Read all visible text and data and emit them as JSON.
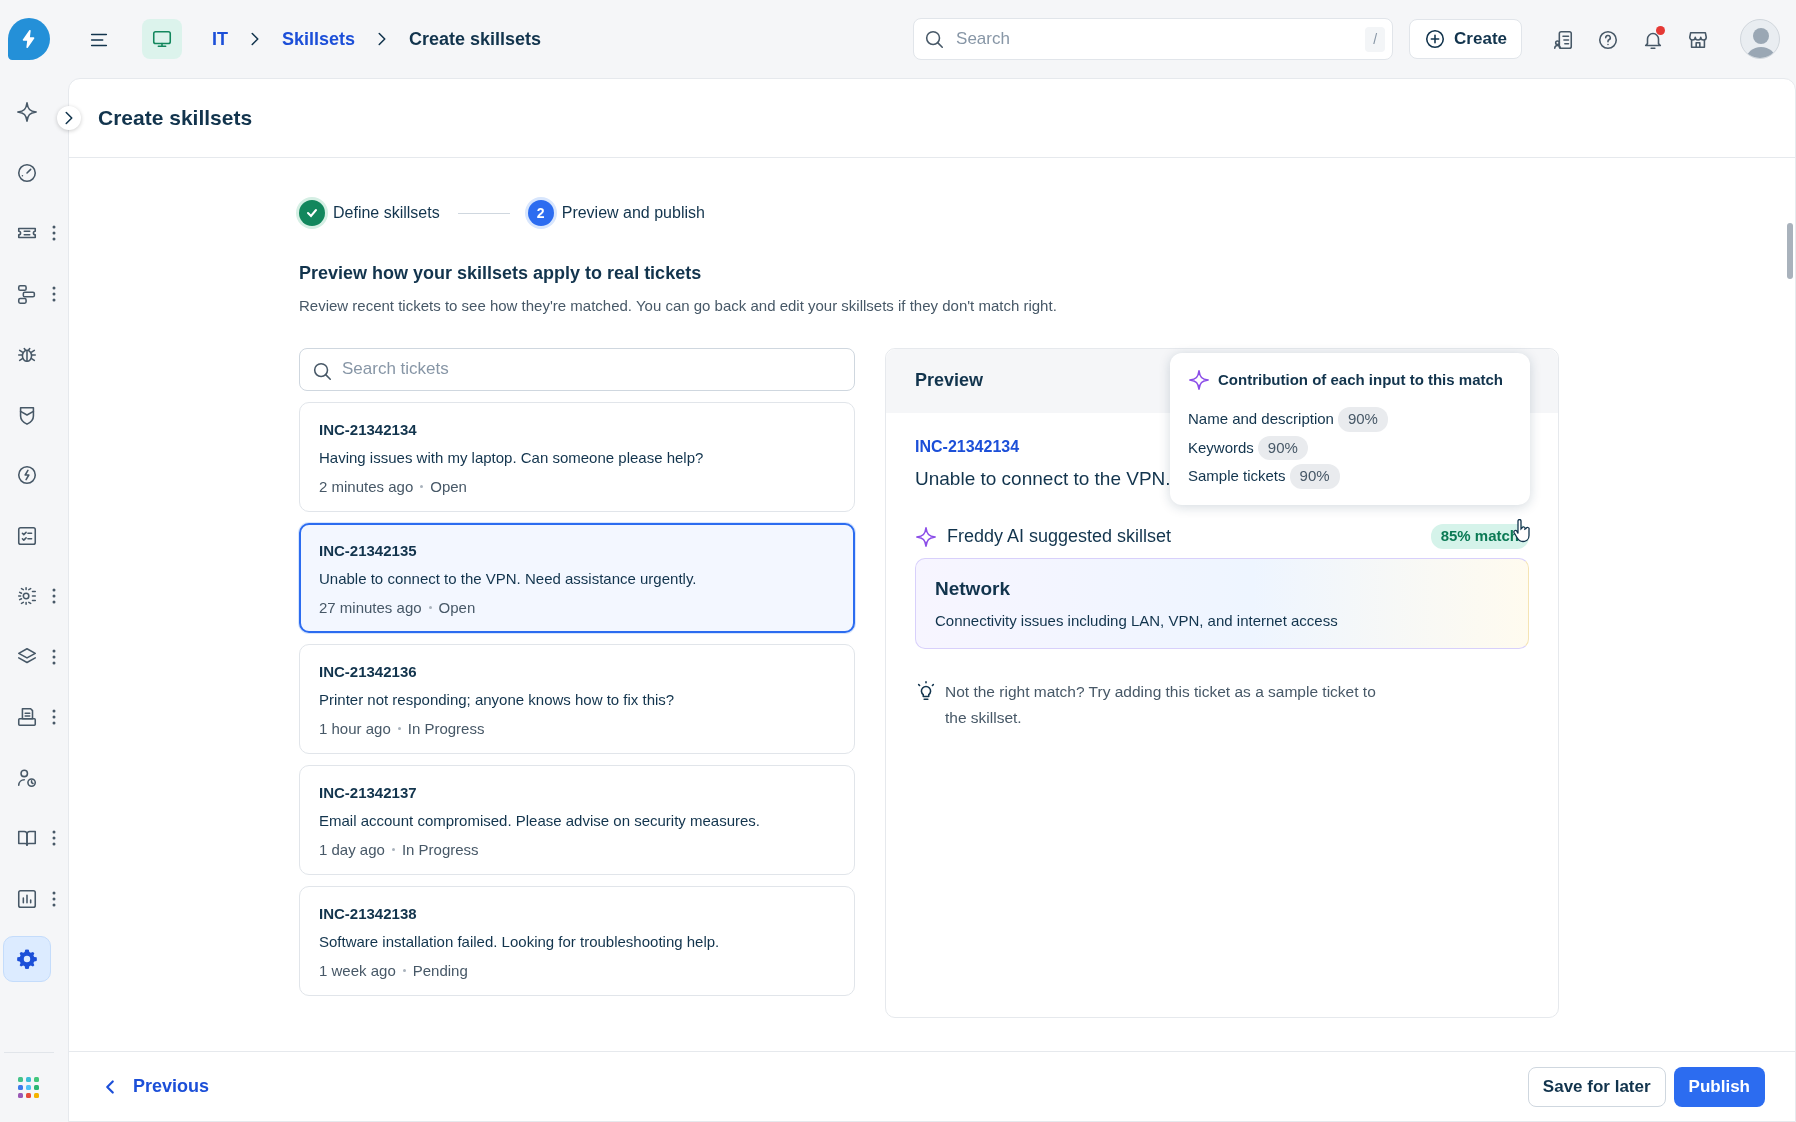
{
  "topbar": {
    "breadcrumbs": [
      {
        "label": "IT",
        "link": true
      },
      {
        "label": "Skillsets",
        "link": true
      },
      {
        "label": "Create skillsets",
        "link": false
      }
    ],
    "search": {
      "placeholder": "Search",
      "shortcut": "/"
    },
    "create_button": "Create",
    "notifications_unread": true
  },
  "sidebar": {
    "items": [
      {
        "selected": false,
        "more": false
      },
      {
        "selected": false,
        "more": false
      },
      {
        "selected": false,
        "more": true
      },
      {
        "selected": false,
        "more": true
      },
      {
        "selected": false,
        "more": false
      },
      {
        "selected": false,
        "more": false
      },
      {
        "selected": false,
        "more": false
      },
      {
        "selected": false,
        "more": false
      },
      {
        "selected": false,
        "more": true
      },
      {
        "selected": false,
        "more": true
      },
      {
        "selected": false,
        "more": true
      },
      {
        "selected": false,
        "more": false
      },
      {
        "selected": false,
        "more": true
      },
      {
        "selected": false,
        "more": true
      },
      {
        "selected": true,
        "more": false
      }
    ]
  },
  "page_title": "Create skillsets",
  "steps": [
    {
      "label": "Define skillsets",
      "done": true
    },
    {
      "number": "2",
      "label": "Preview and publish",
      "done": false
    }
  ],
  "heading": "Preview how your skillsets apply to real tickets",
  "subheading": "Review recent tickets to see how they're matched. You can go back and edit your skillsets if they don't match right.",
  "ticket_search": {
    "placeholder": "Search tickets"
  },
  "tickets": [
    {
      "id": "INC-21342134",
      "title": "Having issues with my laptop. Can someone please help?",
      "age": "2 minutes ago",
      "status": "Open",
      "selected": false
    },
    {
      "id": "INC-21342135",
      "title": "Unable to connect to the VPN. Need assistance urgently.",
      "age": "27 minutes ago",
      "status": "Open",
      "selected": true
    },
    {
      "id": "INC-21342136",
      "title": "Printer not responding; anyone knows how to fix this?",
      "age": "1 hour ago",
      "status": "In Progress",
      "selected": false
    },
    {
      "id": "INC-21342137",
      "title": "Email account compromised. Please advise on security measures.",
      "age": "1 day ago",
      "status": "In Progress",
      "selected": false
    },
    {
      "id": "INC-21342138",
      "title": "Software installation failed. Looking for troubleshooting help.",
      "age": "1 week ago",
      "status": "Pending",
      "selected": false
    }
  ],
  "preview": {
    "title": "Preview",
    "ticket_id": "INC-21342134",
    "ticket_title": "Unable to connect to the VPN.",
    "suggestion_label": "Freddy AI suggested skillset",
    "match": "85% match",
    "skillset": {
      "name": "Network",
      "description": "Connectivity issues including LAN, VPN, and internet access"
    },
    "tip": "Not the right match? Try adding this ticket as a sample ticket to the skillset.",
    "tooltip": {
      "title": "Contribution of each input to this match",
      "inputs": [
        {
          "label": "Name and description",
          "value": "90%"
        },
        {
          "label": "Keywords",
          "value": "90%"
        },
        {
          "label": "Sample tickets",
          "value": "90%"
        }
      ]
    }
  },
  "footer": {
    "previous": "Previous",
    "save": "Save for later",
    "publish": "Publish"
  }
}
